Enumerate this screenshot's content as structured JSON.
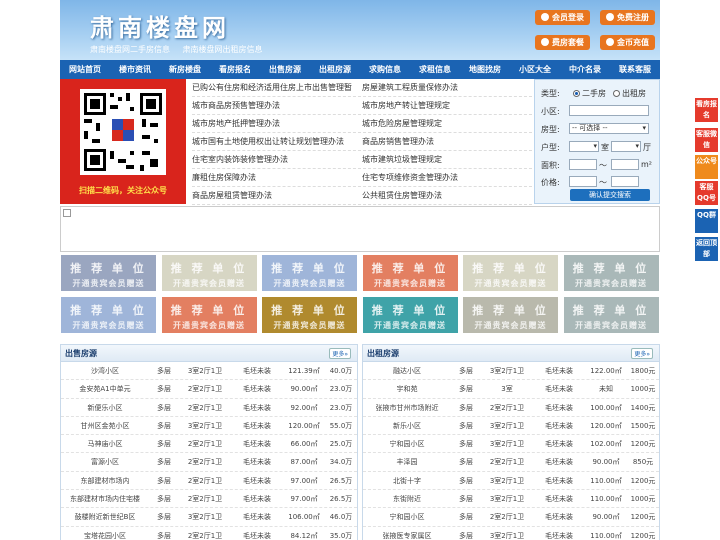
{
  "header": {
    "logo": "肃南楼盘网",
    "sub1": "肃南楼盘网二手房信息",
    "sub2": "肃南楼盘网出租房信息",
    "buttons": [
      "会员登录",
      "免费注册",
      "费房套餐",
      "金币充值"
    ]
  },
  "nav": [
    "网站首页",
    "楼市资讯",
    "新房楼盘",
    "看房报名",
    "出售房源",
    "出租房源",
    "求购信息",
    "求租信息",
    "地图找房",
    "小区大全",
    "中介名录",
    "联系客服"
  ],
  "qr": {
    "caption": "扫描二维码，关注公众号"
  },
  "links": [
    [
      "已购公有住房和经济适用住房上市出售管理暂",
      "房屋建筑工程质量保修办法"
    ],
    [
      "城市商品房预售管理办法",
      "城市房地产转让管理规定"
    ],
    [
      "城市房地产抵押管理办法",
      "城市危险房屋管理规定"
    ],
    [
      "城市国有土地使用权出让转让规划管理办法",
      "商品房销售管理办法"
    ],
    [
      "住宅室内装饰装修管理办法",
      "城市建筑垃圾管理规定"
    ],
    [
      "廉租住房保障办法",
      "住宅专项维修资金管理办法"
    ],
    [
      "商品房屋租赁管理办法",
      "公共租赁住房管理办法"
    ]
  ],
  "search": {
    "type_label": "类型:",
    "opt1": "二手房",
    "opt2": "出租房",
    "community_label": "小区:",
    "housing_label": "房型:",
    "housing_value": "-- 可选择 --",
    "layout_label": "户型:",
    "room_unit": "室",
    "hall_unit": "厅",
    "area_label": "面积:",
    "area_unit": "m²",
    "price_label": "价格:",
    "tilde": "～",
    "submit": "确认提交搜索"
  },
  "recommend": {
    "title": "推 荐 单 位",
    "subtitle": "开通贵宾会员赠送",
    "colors": [
      "#9aa6c0",
      "#d7d6c4",
      "#9fb5d9",
      "#e37f61",
      "#d7d6c4",
      "#a9b8b8",
      "#9fb5d9",
      "#e37f61",
      "#b08a2e",
      "#3fa3a8",
      "#b9b9ac",
      "#a9b8b8"
    ]
  },
  "sale": {
    "title": "出售房源",
    "more": "更多»",
    "rows": [
      [
        "沙湾小区",
        "多层",
        "3室2厅1卫",
        "毛坯未装",
        "121.39㎡",
        "40.0万"
      ],
      [
        "金安苑A1中单元",
        "多层",
        "2室2厅1卫",
        "毛坯未装",
        "90.00㎡",
        "23.0万"
      ],
      [
        "新便乐小区",
        "多层",
        "2室2厅1卫",
        "毛坯未装",
        "92.00㎡",
        "23.0万"
      ],
      [
        "甘州区金苑小区",
        "多层",
        "3室2厅1卫",
        "毛坯未装",
        "120.00㎡",
        "55.0万"
      ],
      [
        "马神庙小区",
        "多层",
        "2室2厅1卫",
        "毛坯未装",
        "66.00㎡",
        "25.0万"
      ],
      [
        "富源小区",
        "多层",
        "2室2厅1卫",
        "毛坯未装",
        "87.00㎡",
        "34.0万"
      ],
      [
        "东部建材市场内",
        "多层",
        "2室2厅1卫",
        "毛坯未装",
        "97.00㎡",
        "26.5万"
      ],
      [
        "东部建材市场内住宅楼",
        "多层",
        "2室2厅1卫",
        "毛坯未装",
        "97.00㎡",
        "26.5万"
      ],
      [
        "鼓楼附近新世纪B区",
        "多层",
        "3室2厅1卫",
        "毛坯未装",
        "106.00㎡",
        "46.0万"
      ],
      [
        "宝塔花园小区",
        "多层",
        "2室2厅1卫",
        "毛坯未装",
        "84.12㎡",
        "35.0万"
      ]
    ]
  },
  "rent": {
    "title": "出租房源",
    "more": "更多»",
    "rows": [
      [
        "融达小区",
        "多层",
        "3室2厅1卫",
        "毛坯未装",
        "122.00㎡",
        "1800元"
      ],
      [
        "宇和苑",
        "多层",
        "3室",
        "毛坯未装",
        "未知",
        "1000元"
      ],
      [
        "张掖市甘州市场附近",
        "多层",
        "2室2厅1卫",
        "毛坯未装",
        "100.00㎡",
        "1400元"
      ],
      [
        "新乐小区",
        "多层",
        "3室2厅1卫",
        "毛坯未装",
        "120.00㎡",
        "1500元"
      ],
      [
        "宁和园小区",
        "多层",
        "3室2厅1卫",
        "毛坯未装",
        "102.00㎡",
        "1200元"
      ],
      [
        "丰泽园",
        "多层",
        "2室2厅1卫",
        "毛坯未装",
        "90.00㎡",
        "850元"
      ],
      [
        "北街十字",
        "多层",
        "3室2厅1卫",
        "毛坯未装",
        "110.00㎡",
        "1200元"
      ],
      [
        "东街附近",
        "多层",
        "3室2厅1卫",
        "毛坯未装",
        "110.00㎡",
        "1000元"
      ],
      [
        "宁和园小区",
        "多层",
        "2室2厅1卫",
        "毛坯未装",
        "90.00㎡",
        "1200元"
      ],
      [
        "张掖医专家属区",
        "多层",
        "3室2厅1卫",
        "毛坯未装",
        "110.00㎡",
        "1200元"
      ]
    ]
  },
  "side": [
    {
      "label": "看房报名",
      "color": "#e53a2c"
    },
    {
      "label": "客服微信",
      "color": "#e53a2c"
    },
    {
      "label": "公众号",
      "color": "#ef8a1c"
    },
    {
      "label": "客服QQ号",
      "color": "#e53a2c"
    },
    {
      "label": "QQ群",
      "color": "#1b63b3"
    },
    {
      "label": "返回顶部",
      "color": "#1b63b3"
    }
  ]
}
